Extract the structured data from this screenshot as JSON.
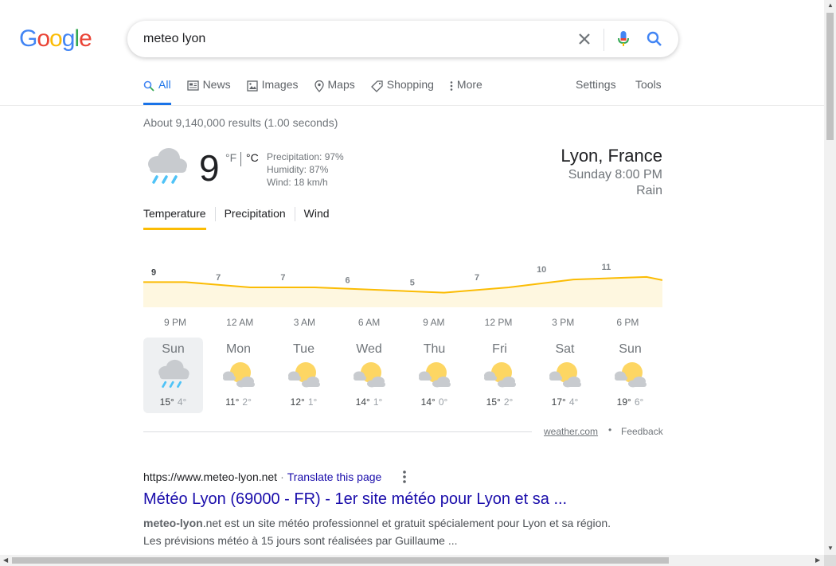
{
  "logo": {
    "letters": [
      "G",
      "o",
      "o",
      "g",
      "l",
      "e"
    ],
    "colors": [
      "#4285F4",
      "#EA4335",
      "#FBBC05",
      "#4285F4",
      "#34A853",
      "#EA4335"
    ]
  },
  "search": {
    "query": "meteo lyon"
  },
  "tabs": [
    {
      "label": "All",
      "icon": "search-icon",
      "active": true
    },
    {
      "label": "News",
      "icon": "news-icon"
    },
    {
      "label": "Images",
      "icon": "image-icon"
    },
    {
      "label": "Maps",
      "icon": "map-pin-icon"
    },
    {
      "label": "Shopping",
      "icon": "tag-icon"
    },
    {
      "label": "More",
      "icon": "more-vert-icon"
    }
  ],
  "tools": {
    "settings": "Settings",
    "tools": "Tools"
  },
  "results_stats": "About 9,140,000 results (1.00 seconds)",
  "weather": {
    "temp": "9",
    "unit_f": "°F",
    "unit_c": "°C",
    "precipitation": "Precipitation: 97%",
    "humidity": "Humidity: 87%",
    "wind": "Wind: 18 km/h",
    "location": "Lyon, France",
    "time": "Sunday 8:00 PM",
    "condition": "Rain",
    "tabs": [
      "Temperature",
      "Precipitation",
      "Wind"
    ],
    "source": "weather.com",
    "feedback": "Feedback"
  },
  "chart_data": {
    "type": "area",
    "x": [
      "9 PM",
      "12 AM",
      "3 AM",
      "6 AM",
      "9 AM",
      "12 PM",
      "3 PM",
      "6 PM"
    ],
    "values": [
      9,
      7,
      7,
      6,
      5,
      7,
      10,
      11
    ],
    "ylim": [
      0,
      14
    ],
    "colors": {
      "line": "#fbbc04",
      "fill": "#fef7e0",
      "label": "#80868b"
    }
  },
  "days": [
    {
      "name": "Sun",
      "hi": "15°",
      "lo": "4°",
      "icon": "rain-cloud-icon",
      "selected": true
    },
    {
      "name": "Mon",
      "hi": "11°",
      "lo": "2°",
      "icon": "partly-cloudy-icon"
    },
    {
      "name": "Tue",
      "hi": "12°",
      "lo": "1°",
      "icon": "partly-cloudy-icon"
    },
    {
      "name": "Wed",
      "hi": "14°",
      "lo": "1°",
      "icon": "partly-cloudy-icon"
    },
    {
      "name": "Thu",
      "hi": "14°",
      "lo": "0°",
      "icon": "partly-cloudy-icon"
    },
    {
      "name": "Fri",
      "hi": "15°",
      "lo": "2°",
      "icon": "partly-cloudy-icon"
    },
    {
      "name": "Sat",
      "hi": "17°",
      "lo": "4°",
      "icon": "partly-cloudy-icon"
    },
    {
      "name": "Sun",
      "hi": "19°",
      "lo": "6°",
      "icon": "partly-cloudy-icon"
    }
  ],
  "result": {
    "url": "https://www.meteo-lyon.net",
    "separator": "·",
    "translate": "Translate this page",
    "title": "Météo Lyon (69000 - FR) - 1er site météo pour Lyon et sa ...",
    "snippet_bold": "meteo-lyon",
    "snippet_rest": ".net est un site météo professionnel et gratuit spécialement pour Lyon et sa région.",
    "snippet_line2": "Les prévisions météo à 15 jours sont réalisées par Guillaume ..."
  }
}
